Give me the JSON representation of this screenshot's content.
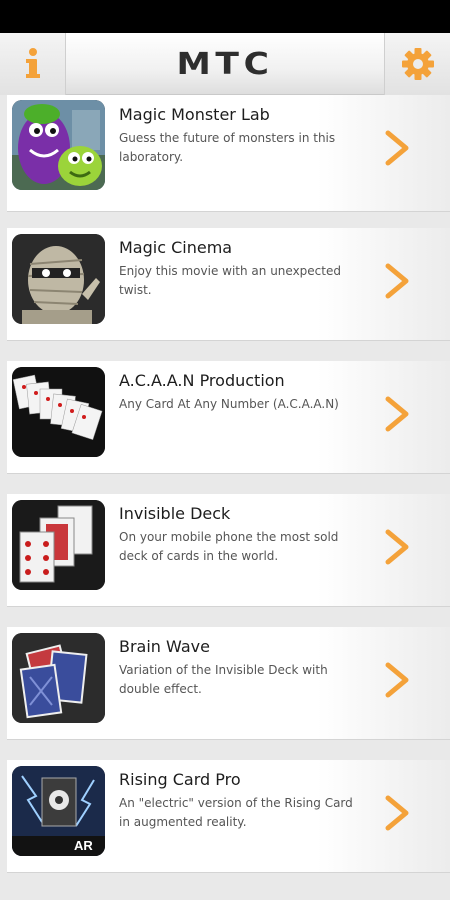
{
  "app": {
    "title": "MTC"
  },
  "header": {
    "info_icon": "info-icon",
    "settings_icon": "gear-icon",
    "accent": "#f4a23a"
  },
  "items": [
    {
      "title": "Magic Monster Lab",
      "description": "Guess the future of monsters in this laboratory.",
      "icon": "monster-thumbnail"
    },
    {
      "title": "Magic Cinema",
      "description": "Enjoy this movie with an unexpected twist.",
      "icon": "mummy-thumbnail"
    },
    {
      "title": "A.C.A.A.N Production",
      "description": "Any Card At Any Number (A.C.A.A.N)",
      "icon": "cards-spread-thumbnail"
    },
    {
      "title": "Invisible Deck",
      "description": "On your mobile phone the most sold deck of cards in the world.",
      "icon": "playing-cards-thumbnail"
    },
    {
      "title": "Brain Wave",
      "description": "Variation of the Invisible Deck with double effect.",
      "icon": "blue-cards-thumbnail"
    },
    {
      "title": "Rising Card Pro",
      "description": "An \"electric\" version of the Rising Card in augmented reality.",
      "icon": "rising-card-thumbnail",
      "badge": "AR"
    }
  ]
}
